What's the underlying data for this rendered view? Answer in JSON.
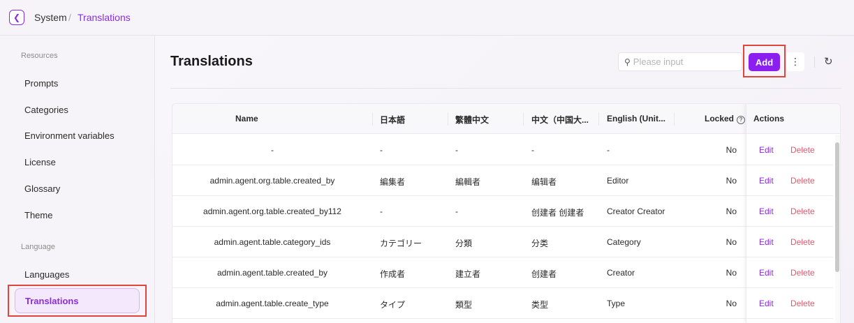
{
  "breadcrumb": {
    "root": "System",
    "separator": "/",
    "current": "Translations"
  },
  "sidebar": {
    "sections": [
      {
        "title": "Resources",
        "items": [
          "Prompts",
          "Categories",
          "Environment variables",
          "License",
          "Glossary",
          "Theme"
        ]
      },
      {
        "title": "Language",
        "items": [
          "Languages",
          "Translations"
        ]
      }
    ],
    "active": "Translations"
  },
  "main": {
    "title": "Translations",
    "search_placeholder": "Please input",
    "add_label": "Add",
    "columns": {
      "name": "Name",
      "ja": "日本語",
      "zh_tw": "繁體中文",
      "zh_cn": "中文（中国大...",
      "en": "English (Unit...",
      "locked": "Locked",
      "actions": "Actions"
    },
    "edit_label": "Edit",
    "delete_label": "Delete",
    "rows": [
      {
        "name": "-",
        "ja": "-",
        "zh_tw": "-",
        "zh_cn": "-",
        "en": "-",
        "locked": "No"
      },
      {
        "name": "admin.agent.org.table.created_by",
        "ja": "編集者",
        "zh_tw": "編輯者",
        "zh_cn": "编辑者",
        "en": "Editor",
        "locked": "No"
      },
      {
        "name": "admin.agent.org.table.created_by112",
        "ja": "-",
        "zh_tw": "-",
        "zh_cn": "创建者 创建者",
        "en": "Creator Creator",
        "locked": "No"
      },
      {
        "name": "admin.agent.table.category_ids",
        "ja": "カテゴリー",
        "zh_tw": "分類",
        "zh_cn": "分类",
        "en": "Category",
        "locked": "No"
      },
      {
        "name": "admin.agent.table.created_by",
        "ja": "作成者",
        "zh_tw": "建立者",
        "zh_cn": "创建者",
        "en": "Creator",
        "locked": "No"
      },
      {
        "name": "admin.agent.table.create_type",
        "ja": "タイプ",
        "zh_tw": "類型",
        "zh_cn": "类型",
        "en": "Type",
        "locked": "No"
      }
    ]
  },
  "colors": {
    "accent": "#8a2be2",
    "add_button": "#8a1ff0",
    "delete": "#e8546a",
    "highlight": "#e0453c"
  },
  "icons": {
    "back": "chevron-left-icon",
    "search": "search-icon",
    "more": "more-vertical-icon",
    "refresh": "refresh-icon",
    "help": "help-circle-icon"
  }
}
